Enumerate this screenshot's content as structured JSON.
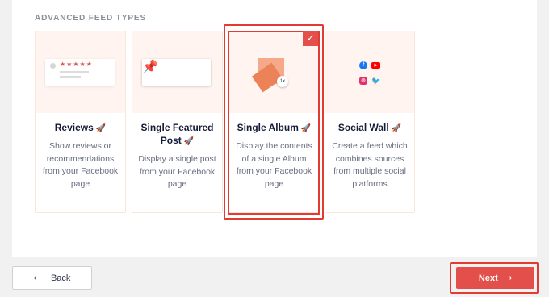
{
  "section": {
    "title": "ADVANCED FEED TYPES"
  },
  "cards": [
    {
      "title": "Reviews",
      "description": "Show reviews or recommendations from your Facebook page",
      "icon": "rocket-icon"
    },
    {
      "title": "Single Featured Post",
      "description": "Display a single post from your Facebook page",
      "icon": "rocket-icon"
    },
    {
      "title": "Single Album",
      "description": "Display the contents of a single Album from your Facebook page",
      "icon": "rocket-icon",
      "selected": true
    },
    {
      "title": "Social Wall",
      "description": "Create a feed which combines sources from multiple social platforms",
      "icon": "rocket-icon"
    }
  ],
  "illustrations": {
    "reviews_stars": "★★★★★",
    "album_count": "1x"
  },
  "footer": {
    "back_label": "Back",
    "next_label": "Next"
  },
  "colors": {
    "accent": "#e34f4a",
    "card_top_bg": "#fff4ef",
    "selection_outline": "#e33a32"
  }
}
